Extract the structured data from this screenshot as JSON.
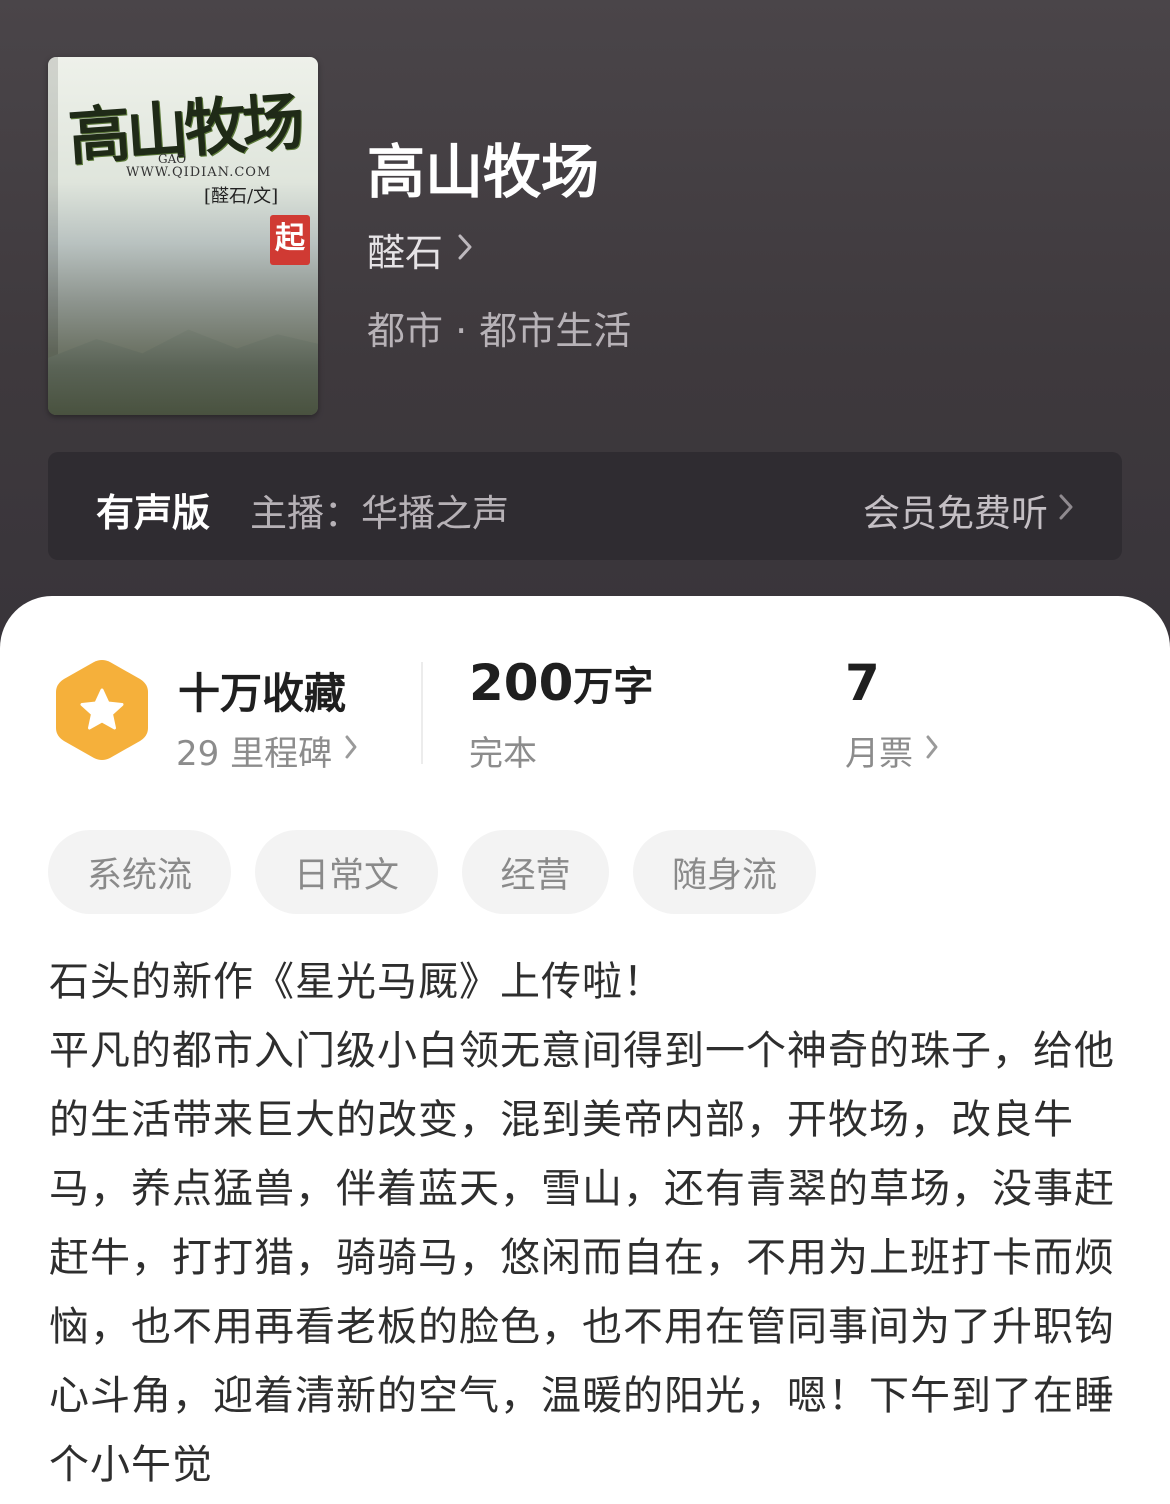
{
  "book": {
    "title": "高山牧场",
    "author": "醛石",
    "genre": "都市 · 都市生活"
  },
  "cover": {
    "title_text": "高山牧场",
    "pinyin": "GAO",
    "url_text": "WWW.QIDIAN.COM",
    "author_text": "[醛石/文]",
    "seal_text": "起"
  },
  "audio": {
    "tag": "有声版",
    "host": "主播：华播之声",
    "cta": "会员免费听"
  },
  "stats": {
    "favorites": "十万收藏",
    "milestones": "29 里程碑",
    "word_count_num": "200",
    "word_count_unit": "万字",
    "status": "完本",
    "monthly_votes_num": "7",
    "monthly_votes_label": "月票"
  },
  "tags": [
    "系统流",
    "日常文",
    "经营",
    "随身流"
  ],
  "description": {
    "line1": "石头的新作《星光马厩》上传啦！",
    "body": "平凡的都市入门级小白领无意间得到一个神奇的珠子，给他的生活带来巨大的改变，混到美帝内部，开牧场，改良牛马，养点猛兽，伴着蓝天，雪山，还有青翠的草场，没事赶赶牛，打打猎，骑骑马，悠闲而自在，不用为上班打卡而烦恼，也不用再看老板的脸色，也不用在管同事间为了升职钩心斗角，迎着清新的空气，温暖的阳光，嗯！下午到了在睡个小午觉"
  },
  "colors": {
    "hero_bg": "#423d41",
    "badge": "#f5b03b",
    "card_bg": "#ffffff",
    "tag_bg": "#f3f3f3"
  },
  "icons": {
    "chevron": "chevron-right-icon",
    "badge": "star-hexagon-icon"
  }
}
